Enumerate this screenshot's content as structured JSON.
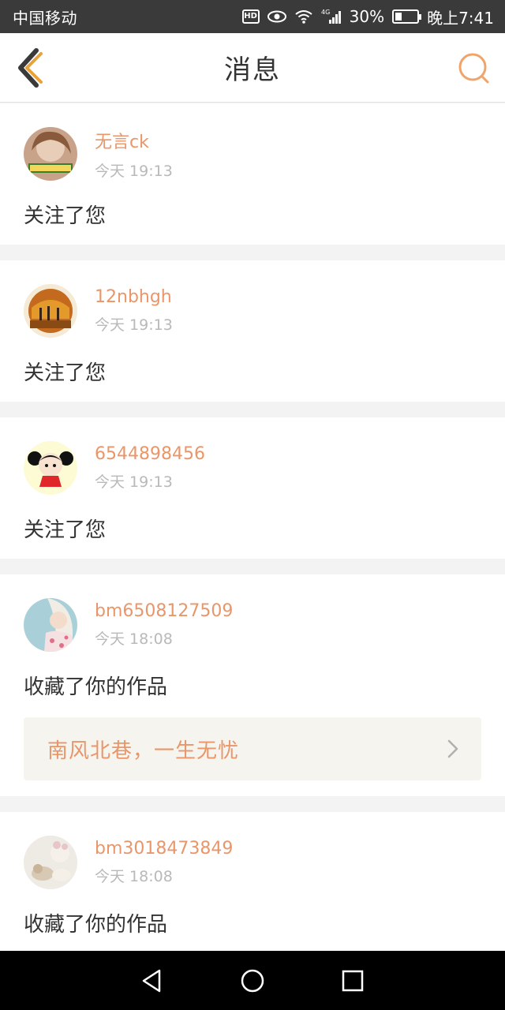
{
  "status_bar": {
    "carrier": "中国移动",
    "network": "4G",
    "battery_percent": "30%",
    "battery_level": 0.3,
    "time": "晚上7:41",
    "icons": [
      "hd-icon",
      "eye-icon",
      "wifi-icon",
      "signal-icon",
      "battery-icon"
    ]
  },
  "nav": {
    "title": "消息",
    "back_icon": "chevron-left-icon",
    "search_icon": "search-icon",
    "accent_color": "#e8a23a"
  },
  "messages": [
    {
      "username": "无言ck",
      "time": "今天 19:13",
      "action": "关注了您"
    },
    {
      "username": "12nbhgh",
      "time": "今天 19:13",
      "action": "关注了您"
    },
    {
      "username": "6544898456",
      "time": "今天 19:13",
      "action": "关注了您"
    },
    {
      "username": "bm6508127509",
      "time": "今天 18:08",
      "action": "收藏了你的作品",
      "work_title": "南风北巷，一生无忧"
    },
    {
      "username": "bm3018473849",
      "time": "今天 18:08",
      "action": "收藏了你的作品"
    }
  ],
  "android_nav": {
    "buttons": [
      "back-triangle-icon",
      "home-circle-icon",
      "recents-square-icon"
    ]
  },
  "colors": {
    "username": "#e8966a",
    "timestamp": "#b9b9b9",
    "separator": "#f3f3f3",
    "work_card_bg": "#f5f4ee"
  }
}
